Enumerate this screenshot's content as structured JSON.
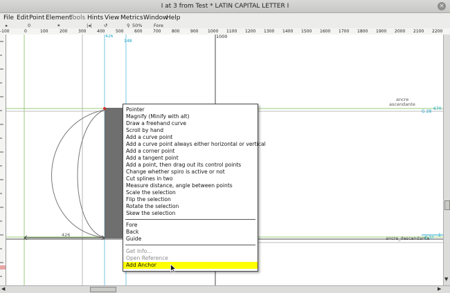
{
  "window": {
    "title": "I at 3 from Test * LATIN CAPITAL LETTER I",
    "close_glyph": "×"
  },
  "menubar": {
    "items": [
      "File",
      "Edit",
      "Point",
      "Element",
      "Tools",
      "Hints",
      "View",
      "Metrics",
      "Window",
      "Help"
    ]
  },
  "toolbar": {
    "coord_x": "0",
    "zoom": "50%",
    "layer_label": "Fore"
  },
  "ruler": {
    "ticks": [
      "-100",
      "0",
      "100",
      "200",
      "300",
      "400",
      "500",
      "600",
      "700",
      "800",
      "900",
      "1000",
      "1100",
      "1200",
      "1300",
      "1400",
      "1500",
      "1600",
      "1700",
      "1800",
      "1900",
      "2000",
      "2100",
      "2200"
    ]
  },
  "canvas": {
    "label_426_top": "426",
    "label_148": "148",
    "label_1000": "1000",
    "anchor_label_top": "ancre",
    "anchor_label_top2": "ascendante",
    "cyan_right_a": "G 28",
    "cyan_right_b": "670",
    "width_label": "426",
    "anchor_label_bottom": "ancre_descendante",
    "cyan_right_c": "G 31",
    "cyan_right_d": "1"
  },
  "context_menu": {
    "items": [
      {
        "label": "Pointer",
        "enabled": true
      },
      {
        "label": "Magnify (Minify with alt)",
        "enabled": true
      },
      {
        "label": "Draw a freehand curve",
        "enabled": true
      },
      {
        "label": "Scroll by hand",
        "enabled": true
      },
      {
        "label": "Add a curve point",
        "enabled": true
      },
      {
        "label": "Add a curve point always either horizontal or vertical",
        "enabled": true
      },
      {
        "label": "Add a corner point",
        "enabled": true
      },
      {
        "label": "Add a tangent point",
        "enabled": true
      },
      {
        "label": "Add a point, then drag out its control points",
        "enabled": true
      },
      {
        "label": "Change whether spiro is active or not",
        "enabled": true
      },
      {
        "label": "Cut splines in two",
        "enabled": true
      },
      {
        "label": "Measure distance, angle between points",
        "enabled": true
      },
      {
        "label": "Scale the selection",
        "enabled": true
      },
      {
        "label": "Flip the selection",
        "enabled": true
      },
      {
        "label": "Rotate the selection",
        "enabled": true
      },
      {
        "label": "Skew the selection",
        "enabled": true
      },
      {
        "label": "Fore",
        "enabled": true
      },
      {
        "label": "Back",
        "enabled": true
      },
      {
        "label": "Guide",
        "enabled": true
      },
      {
        "label": "Get Info...",
        "enabled": false
      },
      {
        "label": "Open Reference",
        "enabled": false
      },
      {
        "label": "Add Anchor",
        "enabled": true,
        "highlighted": true
      }
    ],
    "highlight_color": "#ffff00"
  },
  "colors": {
    "guide_blue": "#1aa6c8",
    "glyph_fill": "#6f6f6f",
    "point_red": "#d92a2a"
  }
}
